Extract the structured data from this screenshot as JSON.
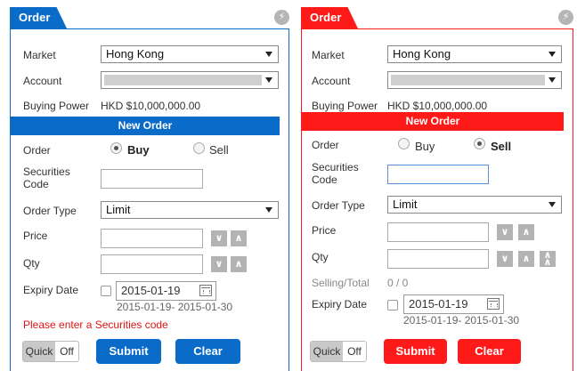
{
  "left": {
    "tab_title": "Order",
    "market": {
      "label": "Market",
      "value": "Hong Kong"
    },
    "account": {
      "label": "Account"
    },
    "buying_power": {
      "label": "Buying Power",
      "value": "HKD $10,000,000.00"
    },
    "bar_title": "New Order",
    "order": {
      "label": "Order",
      "buy": "Buy",
      "sell": "Sell",
      "selected": "Buy"
    },
    "securities_code": {
      "label_line1": "Securities",
      "label_line2": "Code",
      "value": ""
    },
    "order_type": {
      "label": "Order Type",
      "value": "Limit"
    },
    "price": {
      "label": "Price",
      "value": ""
    },
    "qty": {
      "label": "Qty",
      "value": ""
    },
    "expiry": {
      "label": "Expiry Date",
      "date": "2015-01-19",
      "range": "2015-01-19- 2015-01-30"
    },
    "error": "Please enter a Securities code",
    "quick": {
      "on": "Quick",
      "off": "Off"
    },
    "submit": "Submit",
    "clear": "Clear"
  },
  "right": {
    "tab_title": "Order",
    "market": {
      "label": "Market",
      "value": "Hong Kong"
    },
    "account": {
      "label": "Account"
    },
    "buying_power": {
      "label": "Buying Power",
      "value": "HKD $10,000,000.00"
    },
    "bar_title": "New Order",
    "order": {
      "label": "Order",
      "buy": "Buy",
      "sell": "Sell",
      "selected": "Sell"
    },
    "securities_code": {
      "label_line1": "Securities",
      "label_line2": "Code",
      "value": ""
    },
    "order_type": {
      "label": "Order Type",
      "value": "Limit"
    },
    "price": {
      "label": "Price",
      "value": ""
    },
    "qty": {
      "label": "Qty",
      "value": ""
    },
    "selling_total": {
      "label": "Selling/Total",
      "value": "0 / 0"
    },
    "expiry": {
      "label": "Expiry Date",
      "date": "2015-01-19",
      "range": "2015-01-19- 2015-01-30"
    },
    "quick": {
      "on": "Quick",
      "off": "Off"
    },
    "submit": "Submit",
    "clear": "Clear"
  },
  "icons": {
    "lightning": "lightning-icon",
    "chevron_down": "chevron-down-icon",
    "chevron_up": "chevron-up-icon",
    "double_chevron_up": "double-chevron-up-icon",
    "calendar": "calendar-icon"
  },
  "colors": {
    "buy_accent": "#0a6cc8",
    "sell_accent": "#ff1a1a",
    "error": "#e31414"
  }
}
